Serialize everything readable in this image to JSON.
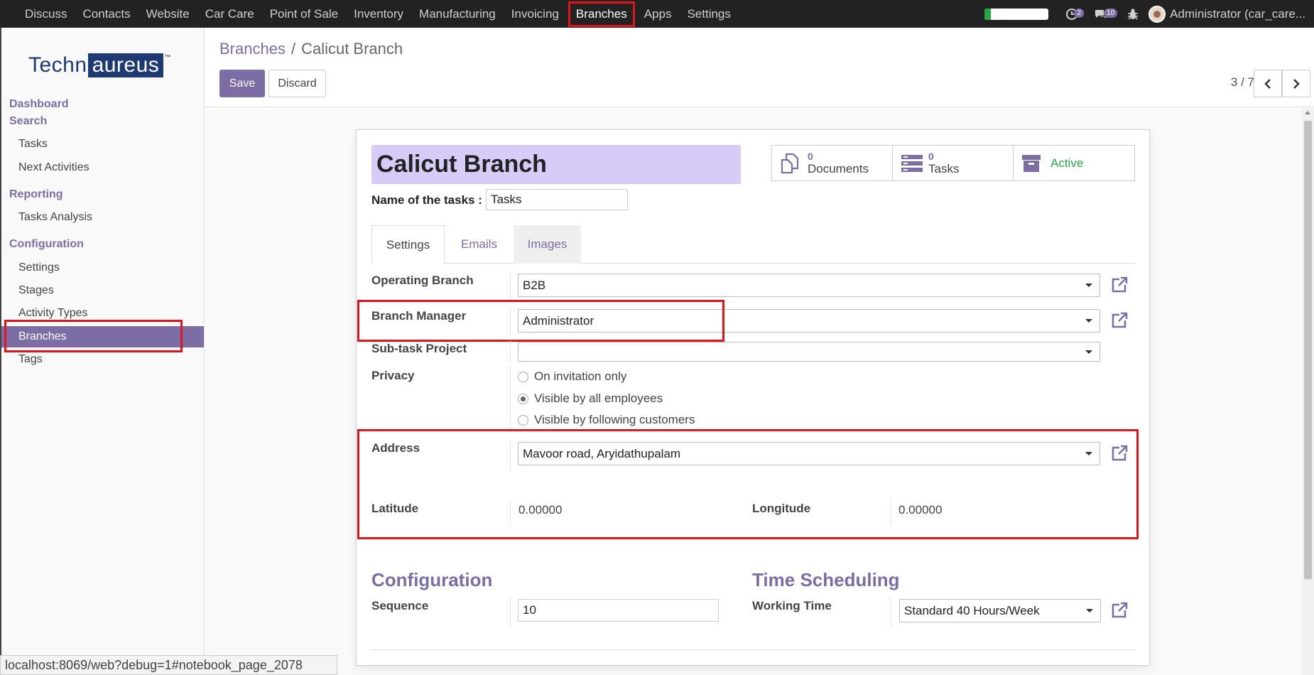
{
  "topnav": {
    "menu": [
      "Discuss",
      "Contacts",
      "Website",
      "Car Care",
      "Point of Sale",
      "Inventory",
      "Manufacturing",
      "Invoicing",
      "Branches",
      "Apps",
      "Settings"
    ],
    "active_item": "Branches",
    "progress_fraction": 0.1,
    "activity_count": "2",
    "message_count": "10",
    "user": "Administrator (car_care..."
  },
  "sidebar": {
    "logo_text_a": "Techn",
    "logo_text_b": "aureus",
    "logo_tm": "™",
    "sections": {
      "dashboard": "Dashboard",
      "search": "Search",
      "reporting": "Reporting",
      "configuration": "Configuration"
    },
    "items": {
      "tasks": "Tasks",
      "next_activities": "Next Activities",
      "tasks_analysis": "Tasks Analysis",
      "settings": "Settings",
      "stages": "Stages",
      "activity_types": "Activity Types",
      "branches": "Branches",
      "tags": "Tags"
    }
  },
  "control": {
    "breadcrumb_parent": "Branches",
    "breadcrumb_sep": "/",
    "breadcrumb_current": "Calicut Branch",
    "save_label": "Save",
    "discard_label": "Discard",
    "pager": "3 / 7"
  },
  "form": {
    "title": "Calicut Branch",
    "tasks_name_label": "Name of the tasks :",
    "tasks_name_value": "Tasks",
    "smart_buttons": {
      "documents_count": "0",
      "documents_label": "Documents",
      "tasks_count": "0",
      "tasks_label": "Tasks",
      "active_label": "Active"
    },
    "tabs": {
      "settings": "Settings",
      "emails": "Emails",
      "images": "Images"
    },
    "fields": {
      "operating_branch_label": "Operating Branch",
      "operating_branch_value": "B2B",
      "branch_manager_label": "Branch Manager",
      "branch_manager_value": "Administrator",
      "subtask_project_label": "Sub-task Project",
      "subtask_project_value": "",
      "privacy_label": "Privacy",
      "privacy_options": [
        "On invitation only",
        "Visible by all employees",
        "Visible by following customers"
      ],
      "privacy_selected": "Visible by all employees",
      "address_label": "Address",
      "address_value": "Mavoor road, Aryidathupalam",
      "latitude_label": "Latitude",
      "latitude_value": "0.00000",
      "longitude_label": "Longitude",
      "longitude_value": "0.00000"
    },
    "configuration": {
      "title": "Configuration",
      "sequence_label": "Sequence",
      "sequence_value": "10"
    },
    "time_scheduling": {
      "title": "Time Scheduling",
      "working_time_label": "Working Time",
      "working_time_value": "Standard 40 Hours/Week"
    }
  },
  "statusbar": {
    "url": "localhost:8069/web?debug=1#notebook_page_2078"
  },
  "colors": {
    "brand": "#7c6da5",
    "highlight": "#e0151b",
    "title_bg": "#d7cbf7",
    "active_green": "#28a745"
  }
}
